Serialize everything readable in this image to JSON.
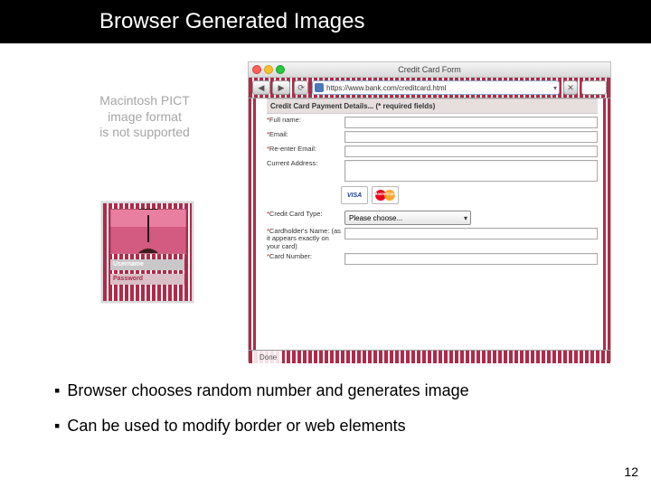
{
  "title": "Browser Generated Images",
  "pict_fallback": {
    "line1": "Macintosh PICT",
    "line2": "image format",
    "line3": "is not supported"
  },
  "thumb": {
    "username_label": "Username",
    "password_label": "Password"
  },
  "browser": {
    "window_title": "Credit Card Form",
    "address_url": "https://www.bank.com/creditcard.html",
    "section_header": "Credit Card Payment Details... (* required fields)",
    "fields": {
      "full_name": "Full name:",
      "email": "Email:",
      "reenter_email": "Re-enter Email:",
      "current_address": "Current Address:",
      "cc_type": "Credit Card Type:",
      "cc_type_value": "Please choose...",
      "cardholder": "Cardholder's Name: (as it appears exactly on your card)",
      "card_number": "Card Number:"
    },
    "cards": {
      "visa": "VISA",
      "mastercard": "MasterCard"
    },
    "status": "Done"
  },
  "bullets": {
    "b1": "Browser chooses random number and generates image",
    "b2": "Can be used to modify border or web elements"
  },
  "page_number": "12"
}
